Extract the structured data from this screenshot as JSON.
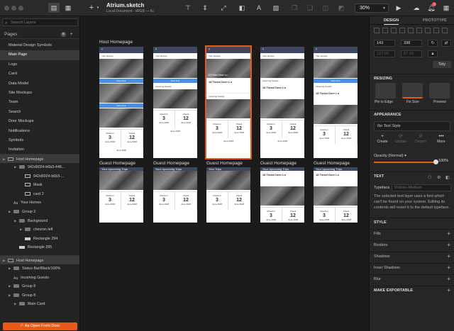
{
  "toolbar": {
    "add_label": "+",
    "doc_title": "Atrium.sketch",
    "doc_subtitle": "Local Document - sRGB — 6c",
    "zoom": "30%",
    "notification_count": "1"
  },
  "left": {
    "search_placeholder": "Search Layers",
    "pages_title": "Pages",
    "pages_badge": "≡",
    "pages": [
      "Material Design Symbols",
      "Main Page",
      "Logo",
      "Card",
      "Data Model",
      "Site Mockups",
      "Team",
      "Search",
      "Door Mockups",
      "Notifications",
      "Symbols",
      "Invitation"
    ],
    "selected_page_index": 1,
    "layers": [
      {
        "label": "Host Homepage",
        "indent": 0,
        "type": "artboard"
      },
      {
        "label": "942d9024-b6b3-448...",
        "indent": 2,
        "type": "folder"
      },
      {
        "label": "942d9024-b6b3-...",
        "indent": 3,
        "type": "img"
      },
      {
        "label": "Mask",
        "indent": 3,
        "type": "img"
      },
      {
        "label": "card 2",
        "indent": 3,
        "type": "img"
      },
      {
        "label": "Your Homes",
        "indent": 1,
        "type": "txt"
      },
      {
        "label": "Group 2",
        "indent": 1,
        "type": "folder"
      },
      {
        "label": "Background",
        "indent": 2,
        "type": "folder"
      },
      {
        "label": "chevron left",
        "indent": 3,
        "type": "folder"
      },
      {
        "label": "Rectangle 294",
        "indent": 3,
        "type": "shape"
      },
      {
        "label": "Rectangle 295",
        "indent": 2,
        "type": "shape"
      },
      {
        "label": "Host Homepage",
        "indent": 0,
        "type": "artboard"
      },
      {
        "label": "Status Bar/Black/100%",
        "indent": 1,
        "type": "folder"
      },
      {
        "label": "Incoming Guests",
        "indent": 1,
        "type": "txt"
      },
      {
        "label": "Group 8",
        "indent": 1,
        "type": "folder"
      },
      {
        "label": "Group 8",
        "indent": 1,
        "type": "folder"
      },
      {
        "label": "Main Card",
        "indent": 2,
        "type": "folder"
      }
    ],
    "open_button": "Open Front Door"
  },
  "canvas": {
    "row1_titles": [
      "Host Homepage",
      "",
      "",
      "",
      ""
    ],
    "row2_titles": [
      "Guest Homepage",
      "Guest Homepage",
      "Guest Homepage",
      "Guest Homepage",
      "Guest Homepage"
    ],
    "texts": {
      "your_homes": "Your Homes",
      "address": "18 Tinkel Deer Ln",
      "view_tour": "View Tour",
      "incoming_guests": "Incoming Guests",
      "check_in": "Check In",
      "check_out": "Check",
      "day_in": "3",
      "day_out": "12",
      "month": "June 2018",
      "your_upcoming": "Your Upcoming Trips",
      "your_trips": "Your Trips"
    }
  },
  "right": {
    "tab_design": "DESIGN",
    "tab_prototype": "PROTOTYPE",
    "x": "143",
    "y": "338",
    "w": "127.99",
    "h": "87.99",
    "tidy": "Tidy",
    "resizing_title": "RESIZING",
    "resize_options": [
      "Pin to Edge",
      "Fix Size",
      "Preview"
    ],
    "appearance_title": "APPEARANCE",
    "style_placeholder": "No Text Style",
    "style_actions": [
      "Create",
      "Update",
      "Detach",
      "More"
    ],
    "opacity_label": "Opacity (Normal)",
    "opacity_value": "100%",
    "opacity_level": 1.0,
    "text_title": "TEXT",
    "typeface_label": "Typeface",
    "typeface_value": "Roboto-Medium",
    "typeface_note": "The selected text layer uses a font which can't be found on your system. Editing its contents will revert it to the default typeface.",
    "style_title": "STYLE",
    "style_rows": [
      "Fills",
      "Borders",
      "Shadows",
      "Inner Shadows",
      "Blur"
    ],
    "export_title": "MAKE EXPORTABLE"
  },
  "colors": {
    "accent": "#e8591a",
    "blue": "#4a90e2",
    "navbar": "#3e4760"
  }
}
